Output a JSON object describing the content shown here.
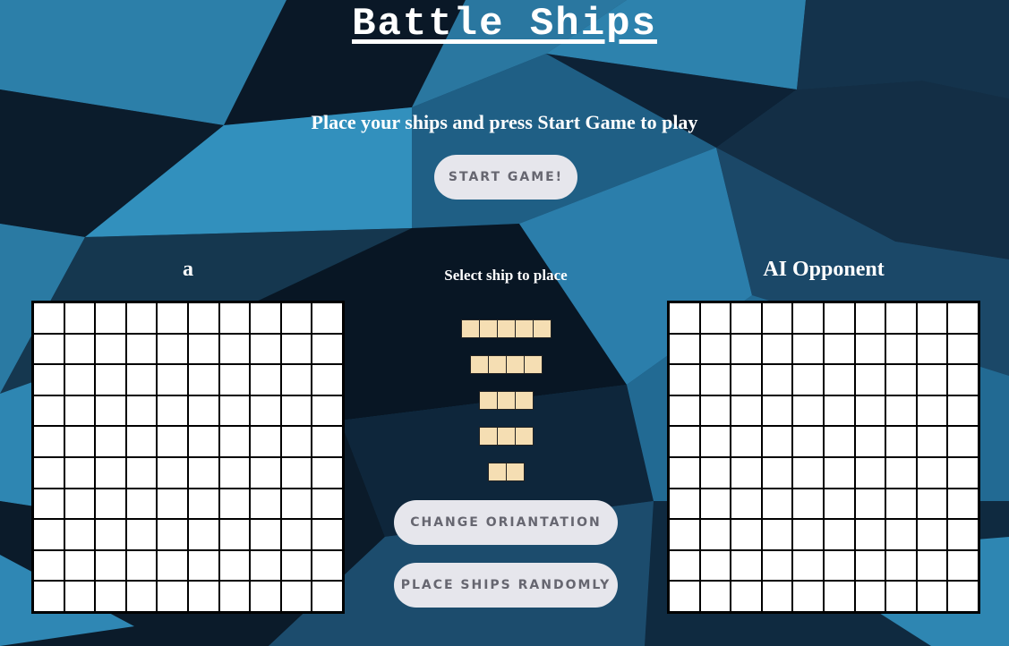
{
  "title": "Battle Ships",
  "instructions": "Place your ships and press Start Game to play",
  "buttons": {
    "start": "Start Game!",
    "change_orientation": "Change Oriantation",
    "place_randomly": "Place Ships Randomly"
  },
  "player_board": {
    "label": "a",
    "rows": 10,
    "cols": 10
  },
  "ai_board": {
    "label": "AI Opponent",
    "rows": 10,
    "cols": 10
  },
  "ship_selector": {
    "label": "Select ship to place",
    "ships": [
      {
        "name": "ship-5",
        "length": 5
      },
      {
        "name": "ship-4",
        "length": 4
      },
      {
        "name": "ship-3a",
        "length": 3
      },
      {
        "name": "ship-3b",
        "length": 3
      },
      {
        "name": "ship-2",
        "length": 2
      }
    ]
  },
  "colors": {
    "ship_fill": "#f5deb3",
    "button_bg": "#e6e6ec",
    "button_text": "#666670",
    "grid_line": "#000000",
    "cell_bg": "#ffffff"
  }
}
